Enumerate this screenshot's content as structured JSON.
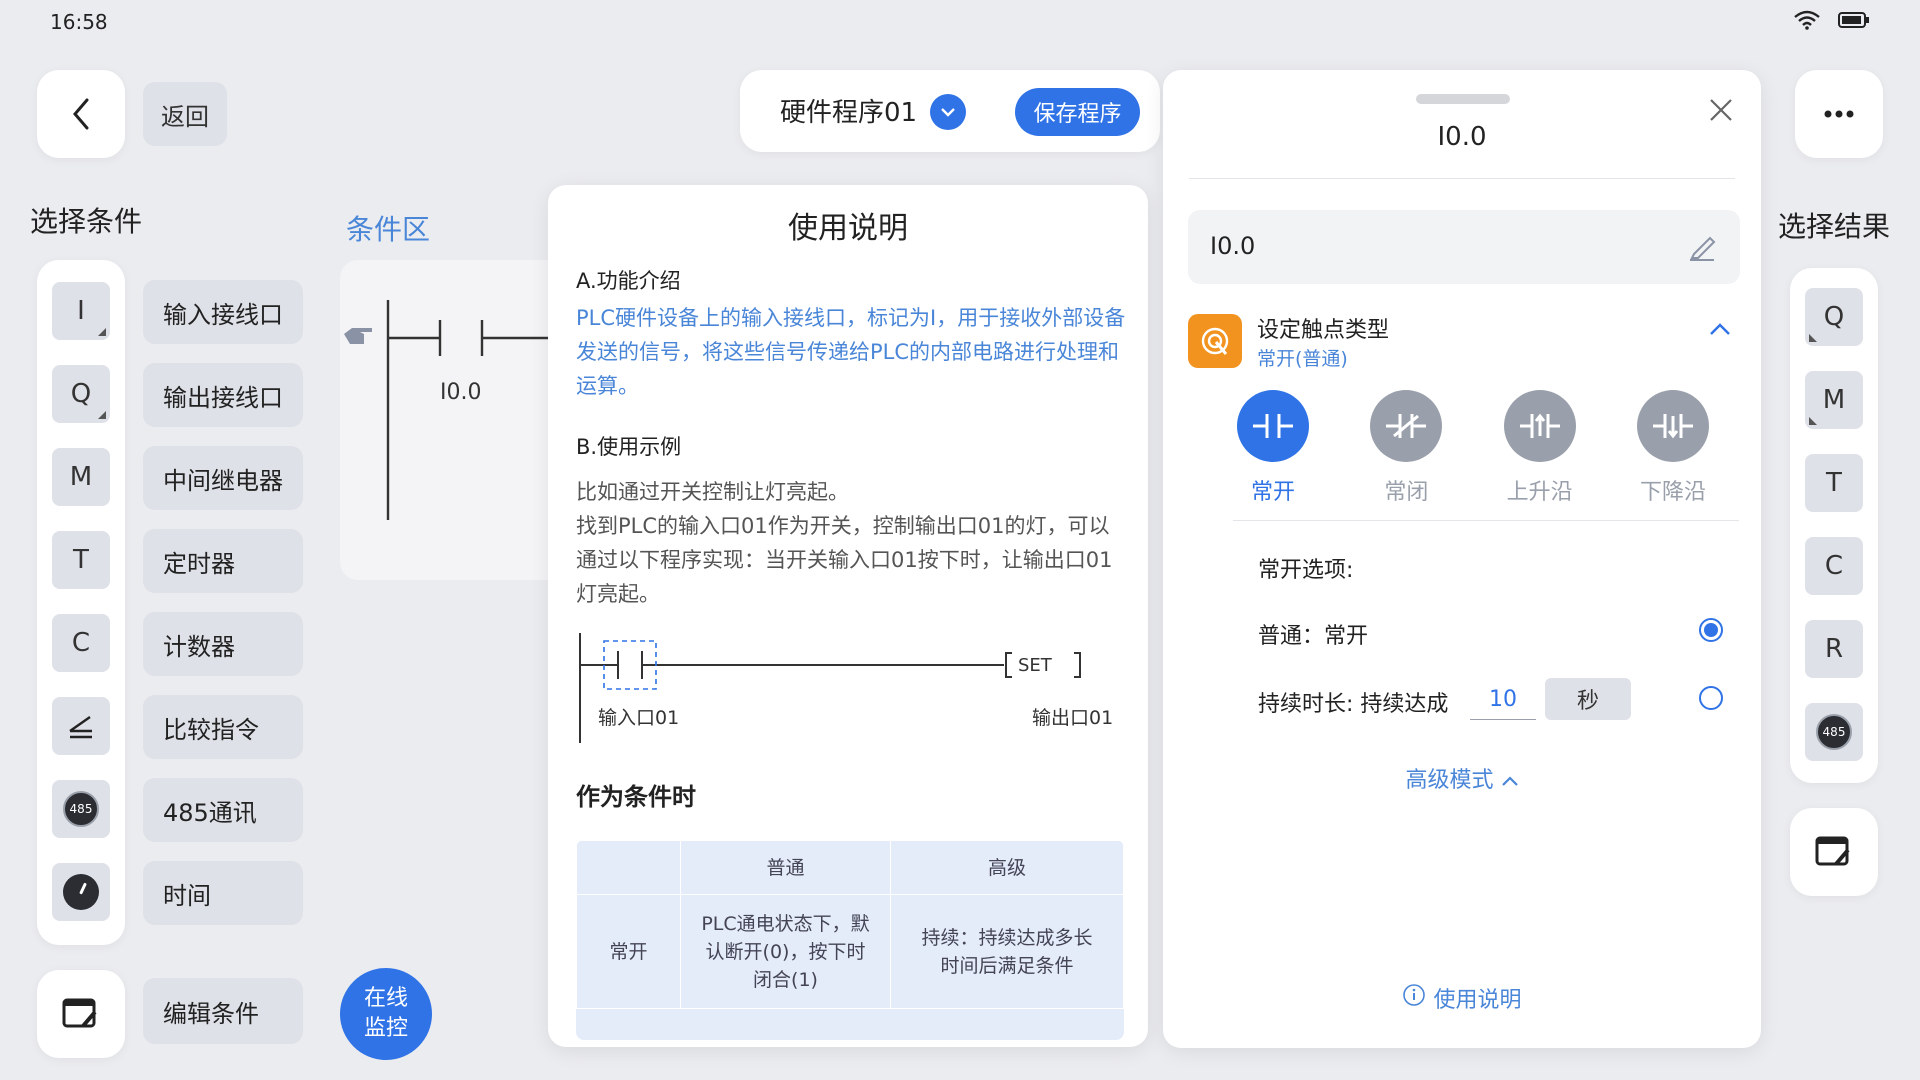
{
  "status": {
    "time": "16:58"
  },
  "nav": {
    "back_label": "返回"
  },
  "left": {
    "title": "选择条件",
    "strip": [
      "I",
      "Q",
      "M",
      "T",
      "C",
      "",
      "485",
      ""
    ],
    "labels": [
      "输入接线口",
      "输出接线口",
      "中间继电器",
      "定时器",
      "计数器",
      "比较指令",
      "485通讯",
      "时间"
    ],
    "edit_label": "编辑条件"
  },
  "condition_area": {
    "title": "条件区",
    "contact_label": "I0.0"
  },
  "online": {
    "line1": "在线",
    "line2": "监控"
  },
  "program": {
    "name": "硬件程序01",
    "save_label": "保存程序"
  },
  "right": {
    "title": "选择结果",
    "strip": [
      "Q",
      "M",
      "T",
      "C",
      "R",
      "485"
    ]
  },
  "help": {
    "title": "使用说明",
    "sec_a": "A.功能介绍",
    "sec_a_text": "PLC硬件设备上的输入接线口，标记为I，用于接收外部设备发送的信号，将这些信号传递给PLC的内部电路进行处理和运算。",
    "sec_b": "B.使用示例",
    "sec_b_text1": "比如通过开关控制让灯亮起。",
    "sec_b_text2": "找到PLC的输入口01作为开关，控制输出口01的灯，可以通过以下程序实现：当开关输入口01按下时，让输出口01灯亮起。",
    "diagram_in": "输入口01",
    "diagram_out": "输出口01",
    "diagram_set": "SET",
    "h2": "作为条件时",
    "table": {
      "head": [
        "",
        "普通",
        "高级"
      ],
      "row": [
        "常开",
        "PLC通电状态下，默认断开(0)，按下时闭合(1)",
        "持续：持续达成多长时间后满足条件"
      ]
    }
  },
  "props": {
    "title": "I0.0",
    "name_value": "I0.0",
    "contact_type_title": "设定触点类型",
    "contact_type_sub": "常开(普通)",
    "types": [
      "常开",
      "常闭",
      "上升沿",
      "下降沿"
    ],
    "options_title": "常开选项:",
    "option_normal": "普通：常开",
    "option_duration": "持续时长: 持续达成",
    "duration_value": "10",
    "duration_unit": "秒",
    "advanced": "高级模式",
    "usage": "使用说明"
  },
  "colors": {
    "accent": "#2f73e6",
    "link": "#4a86d8",
    "orange": "#f3931f",
    "bg": "#ebecf0"
  }
}
